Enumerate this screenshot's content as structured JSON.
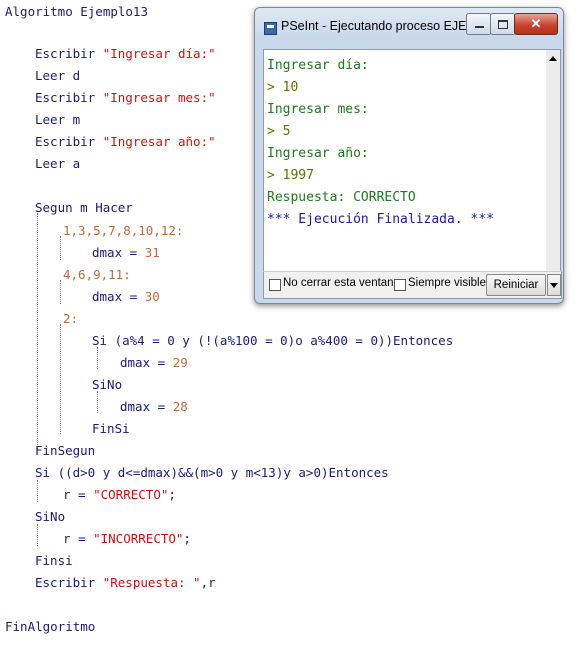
{
  "editor": {
    "lines": [
      {
        "text": "Algoritmo Ejemplo13"
      },
      {
        "text": "Escribir ",
        "str": "\"Ingresar día:\""
      },
      {
        "text": "Leer d"
      },
      {
        "text": "Escribir ",
        "str": "\"Ingresar mes:\""
      },
      {
        "text": "Leer m"
      },
      {
        "text": "Escribir ",
        "str": "\"Ingresar año:\""
      },
      {
        "text": "Leer a"
      },
      {
        "text": "Segun m Hacer"
      },
      {
        "text": "1,3,5,7,8,10,12:"
      },
      {
        "text": "dmax = ",
        "num": "31"
      },
      {
        "text": "4,6,9,11:"
      },
      {
        "text": "dmax = ",
        "num": "30"
      },
      {
        "text": "2:"
      },
      {
        "text": "Si (a%4 = 0 y (!(a%100 = 0)o a%400 = 0))Entonces"
      },
      {
        "text": "dmax = ",
        "num": "29"
      },
      {
        "text": "SiNo"
      },
      {
        "text": "dmax = ",
        "num": "28"
      },
      {
        "text": "FinSi"
      },
      {
        "text": "FinSegun"
      },
      {
        "text": "Si ((d>0 y d<=dmax)&&(m>0 y m<13)y a>0)Entonces"
      },
      {
        "text": "r = ",
        "str": "\"CORRECTO\"",
        "tail": ";"
      },
      {
        "text": "SiNo"
      },
      {
        "text": "r = ",
        "str": "\"INCORRECTO\"",
        "tail": ";"
      },
      {
        "text": "Finsi"
      },
      {
        "text": "Escribir ",
        "str": "\"Respuesta: \"",
        "tail": ",r"
      },
      {
        "text": "FinAlgoritmo"
      }
    ]
  },
  "window": {
    "title": "PSeInt - Ejecutando proceso EJEMP...",
    "console_lines": [
      "Ingresar día:",
      "> 10",
      "Ingresar mes:",
      "> 5",
      "Ingresar año:",
      "> 1997",
      "Respuesta: CORRECTO",
      "*** Ejecución Finalizada. ***"
    ],
    "checkbox_no_cerrar": "No cerrar esta ventana",
    "checkbox_siempre_visible": "Siempre visible",
    "reset_label": "Reiniciar"
  }
}
